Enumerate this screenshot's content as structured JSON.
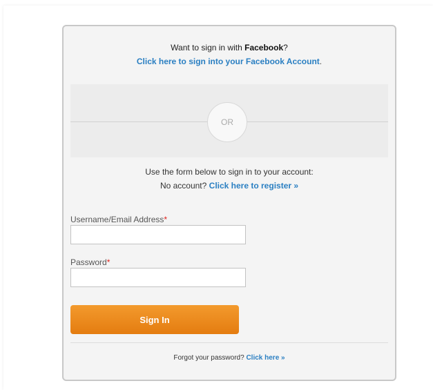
{
  "facebook": {
    "prompt_prefix": "Want to sign in with ",
    "prompt_bold": "Facebook",
    "prompt_suffix": "?",
    "link_text": "Click here to sign into your Facebook Account",
    "link_suffix": "."
  },
  "separator": {
    "label": "OR"
  },
  "info": {
    "line1": "Use the form below to sign in to your account:",
    "no_account_prefix": "No account? ",
    "register_link": "Click here to register »"
  },
  "form": {
    "username_label": "Username/Email Address",
    "password_label": "Password",
    "required_marker": "*",
    "username_value": "",
    "password_value": "",
    "submit_label": "Sign In"
  },
  "forgot": {
    "prefix": "Forgot your password? ",
    "link": "Click here »"
  },
  "colors": {
    "link": "#2a7fc2",
    "button": "#e9861c",
    "required": "#e0201a"
  }
}
